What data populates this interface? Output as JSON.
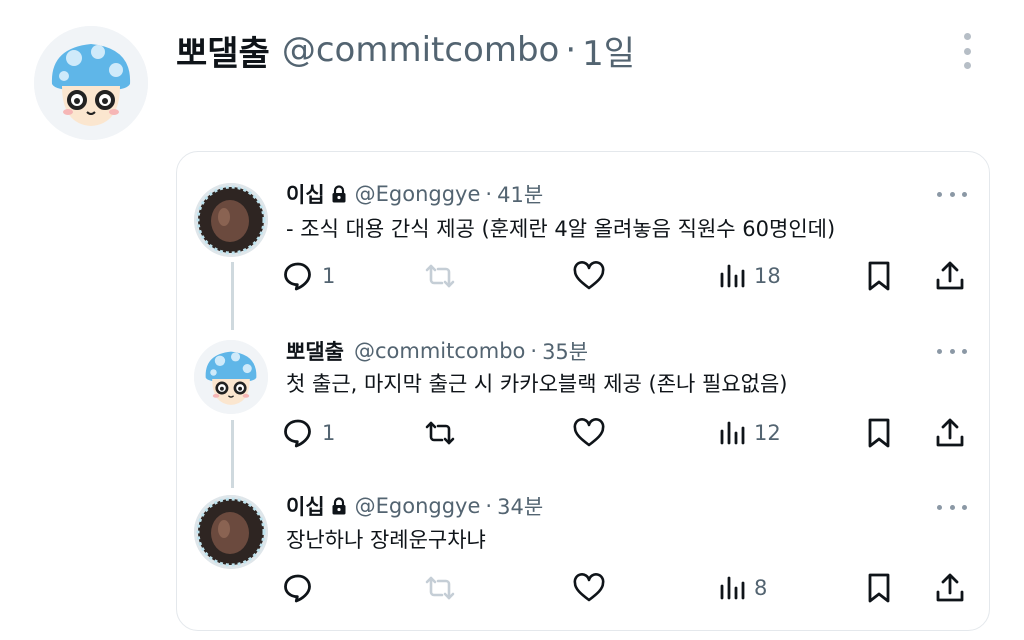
{
  "post": {
    "author_name": "뽀댈출",
    "handle": "@commitcombo",
    "separator": "·",
    "time": "1일",
    "avatar_icon": "mushroom-avatar-icon"
  },
  "quoted_thread": {
    "tweets": [
      {
        "author_name": "이십",
        "protected": true,
        "handle": "@Egonggye",
        "separator": "·",
        "time": "41분",
        "text": "- 조식 대용 간식 제공 (훈제란 4알 올려놓음 직원수 60명인데)",
        "replies": "1",
        "retweets": "",
        "likes": "",
        "views": "18",
        "retweet_enabled": false
      },
      {
        "author_name": "뽀댈출",
        "protected": false,
        "handle": "@commitcombo",
        "separator": "·",
        "time": "35분",
        "text": "첫 출근, 마지막 출근 시 카카오블랙 제공 (존나 필요없음)",
        "replies": "1",
        "retweets": "",
        "likes": "",
        "views": "12",
        "retweet_enabled": true
      },
      {
        "author_name": "이십",
        "protected": true,
        "handle": "@Egonggye",
        "separator": "·",
        "time": "34분",
        "text": "장난하나 장례운구차냐",
        "replies": "",
        "retweets": "",
        "likes": "",
        "views": "8",
        "retweet_enabled": false
      }
    ]
  },
  "colors": {
    "text_primary": "#0f1419",
    "text_secondary": "#536471",
    "icon": "#0f1419",
    "icon_disabled": "#c5ced6",
    "thread_line": "#cfd9de",
    "border": "#e4e8ec",
    "mushroom_cap": "#5fb6e8"
  }
}
